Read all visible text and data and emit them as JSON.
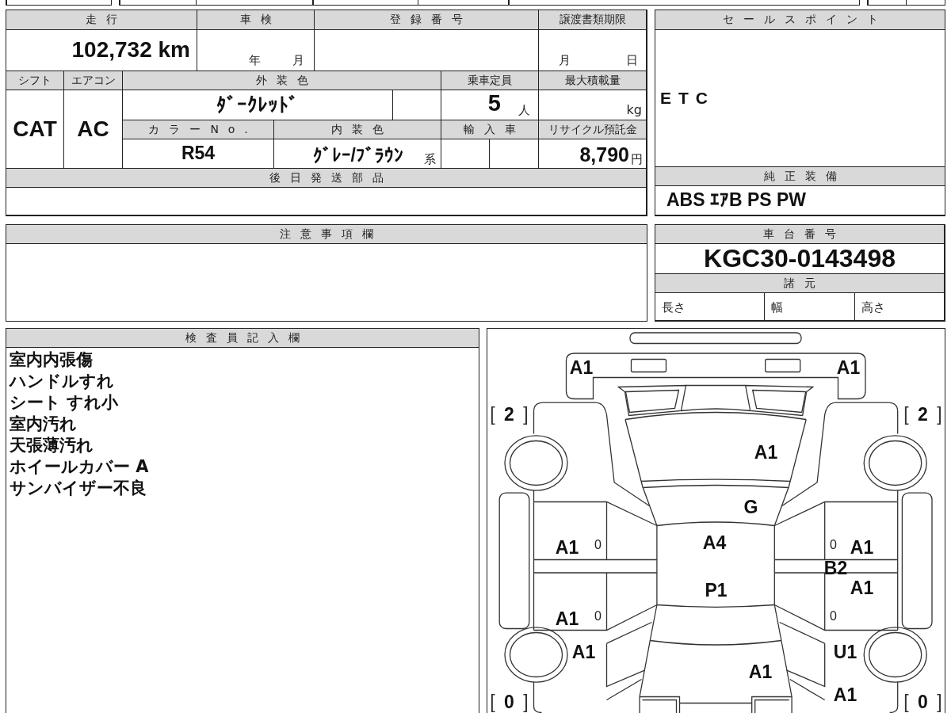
{
  "vehicle_table": {
    "mileage": {
      "label": "走行",
      "value": "102,732 km"
    },
    "inspection": {
      "label": "車検",
      "year_unit": "年",
      "month_unit": "月"
    },
    "registration_number": {
      "label": "登録番号"
    },
    "transfer_deadline": {
      "label": "譲渡書類期限",
      "month_unit": "月",
      "day_unit": "日"
    },
    "shift": {
      "label": "シフト",
      "value": "CAT"
    },
    "air_conditioner": {
      "label": "エアコン",
      "value": "AC"
    },
    "exterior_color": {
      "label": "外装色",
      "value": "ﾀﾞｰｸﾚｯﾄﾞ"
    },
    "seating_capacity": {
      "label": "乗車定員",
      "value": "5",
      "unit": "人"
    },
    "max_load": {
      "label": "最大積載量",
      "unit": "kg"
    },
    "color_number": {
      "label": "カラーNo.",
      "value": "R54"
    },
    "interior_color": {
      "label": "内装色",
      "value": "ｸﾞﾚｰ/ﾌﾞﾗｳﾝ",
      "suffix": "系"
    },
    "imported": {
      "label": "輸入車"
    },
    "recycling_deposit": {
      "label": "リサイクル預託金",
      "value": "8,790",
      "unit": "円"
    },
    "parts_sent_later": {
      "label": "後日発送部品"
    }
  },
  "sales_points": {
    "label": "セールスポイント",
    "text": "ETC"
  },
  "standard_equipment": {
    "label": "純正装備",
    "text": "ABS ｴｱB PS PW"
  },
  "notes": {
    "label": "注意事項欄"
  },
  "chassis": {
    "label": "車台番号",
    "value": "KGC30-0143498",
    "specs_label": "諸元",
    "specs": [
      "長さ",
      "幅",
      "高さ"
    ]
  },
  "inspector_notes": {
    "label": "検査員記入欄",
    "lines": [
      "室内内張傷",
      "ハンドルすれ",
      "シート すれ小",
      "室内汚れ",
      "天張薄汚れ",
      "ホイールカバー A",
      "サンバイザー不良"
    ]
  },
  "damage_diagram": {
    "tread_readings": {
      "front_left": "[ **2** ]",
      "front_right": "[ **2** ]",
      "rear_left": "[ **0** ]",
      "rear_right": "[ **0** ]"
    },
    "codes": {
      "front_bumper_left": "A1",
      "front_bumper_right": "A1",
      "hood": "A1",
      "windshield": "G",
      "left_front_door": "A1",
      "roof_front": "A4",
      "right_front_door": "A1",
      "right_center_pillar": "B2",
      "right_rear_door": "A1",
      "roof_rear": "P1",
      "left_rear_door": "A1",
      "left_rear_fender": "A1",
      "right_rear_fender": "U1",
      "trunk": "A1",
      "right_rear_bumper": "A1"
    },
    "door_marks": {
      "left_front_door": "0",
      "right_front_door": "0",
      "left_rear_door": "0",
      "right_rear_door": "0"
    }
  }
}
